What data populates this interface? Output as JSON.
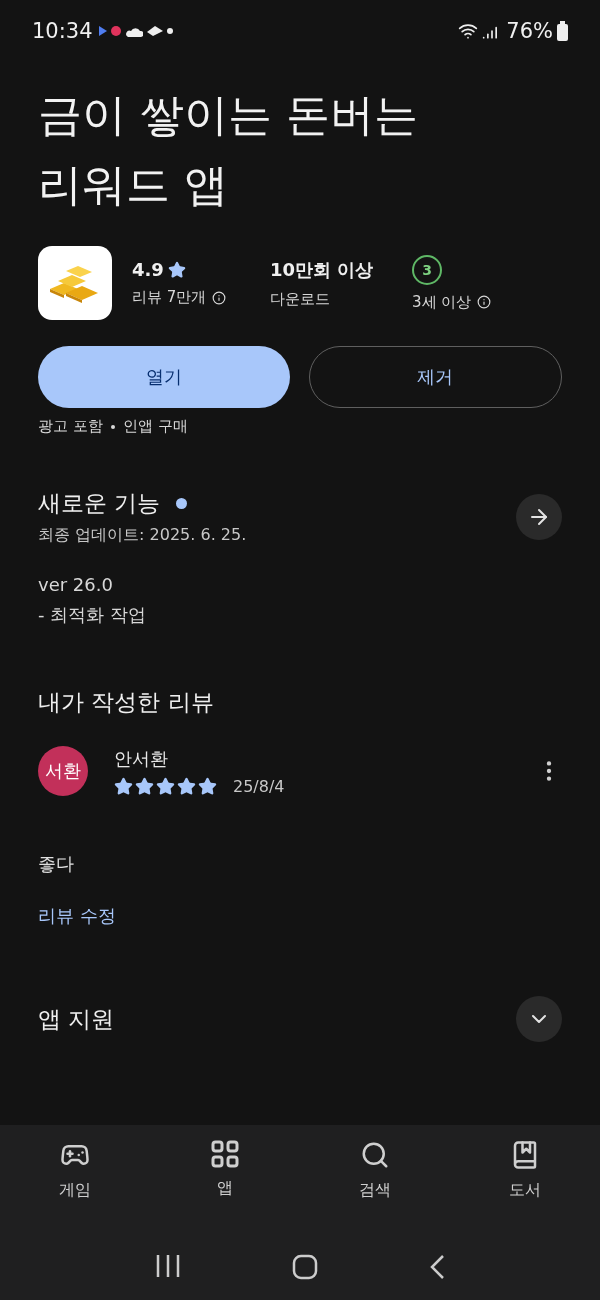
{
  "status_bar": {
    "time": "10:34",
    "battery": "76%"
  },
  "title_lines": [
    "금이 쌓이는 돈버는",
    "리워드 앱"
  ],
  "stats": [
    {
      "kind": "rating",
      "value": "4.9",
      "label": "리뷰 7만개",
      "info": true
    },
    {
      "kind": "downloads",
      "value": "10만회 이상",
      "label": "다운로드",
      "info": false
    },
    {
      "kind": "age",
      "value": "3",
      "label": "3세 이상",
      "info": true
    }
  ],
  "buttons": [
    {
      "label": "열기",
      "kind": "primary"
    },
    {
      "label": "제거",
      "kind": "outline"
    }
  ],
  "tags": [
    "광고 포함",
    "인앱 구매"
  ],
  "whats_new": {
    "title": "새로운 기능",
    "unread": true,
    "updated": "최종 업데이트: 2025. 6. 25.",
    "notes": [
      "ver 26.0",
      "- 최적화 작업"
    ]
  },
  "my_review": {
    "heading": "내가 작성한 리뷰",
    "avatar": {
      "initials": "서환",
      "color": "#c2305a"
    },
    "author": "안서환",
    "stars": 5,
    "date": "25/8/4",
    "text": "좋다",
    "edit_link": "리뷰 수정"
  },
  "sections": [
    {
      "title": "앱 지원",
      "expanded": false
    }
  ],
  "bottom_nav": [
    {
      "label": "게임",
      "kind": "games"
    },
    {
      "label": "앱",
      "kind": "apps"
    },
    {
      "label": "검색",
      "kind": "search"
    },
    {
      "label": "도서",
      "kind": "books"
    }
  ]
}
